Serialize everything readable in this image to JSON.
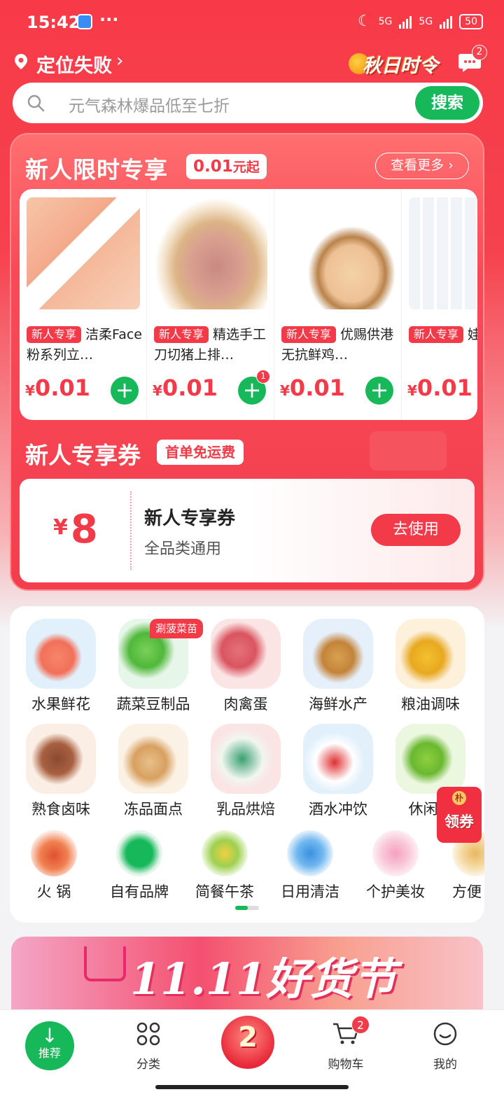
{
  "status": {
    "time": "15:42",
    "dots": "···",
    "net1": "5G",
    "net2": "5G",
    "battery": "50"
  },
  "header": {
    "location": "定位失败",
    "season_badge": "秋日时令",
    "msg_count": "2"
  },
  "search": {
    "placeholder": "元气森林爆品低至七折",
    "button": "搜索"
  },
  "newuser": {
    "title": "新人限时专享",
    "badge_price": "0.01",
    "badge_suffix": "元起",
    "more": "查看更多 ›",
    "products": [
      {
        "tag": "新人专享",
        "name": "洁柔Face粉系列立…",
        "price": "0.01",
        "currency": "¥"
      },
      {
        "tag": "新人专享",
        "name": "精选手工刀切猪上排…",
        "price": "0.01",
        "currency": "¥",
        "cart_count": "1"
      },
      {
        "tag": "新人专享",
        "name": "优赐供港无抗鲜鸡…",
        "price": "0.01",
        "currency": "¥"
      },
      {
        "tag": "新人专享",
        "name": "娃哈哈饮用纯净…",
        "price": "0.01",
        "currency": "¥"
      }
    ]
  },
  "coupon": {
    "section_title": "新人专享券",
    "section_badge": "首单免运费",
    "currency": "¥",
    "amount": "8",
    "name": "新人专享券",
    "desc": "全品类通用",
    "use_button": "去使用"
  },
  "categories": {
    "row1": [
      "水果鲜花",
      "蔬菜豆制品",
      "肉禽蛋",
      "海鲜水产",
      "粮油调味"
    ],
    "row2": [
      "熟食卤味",
      "冻品面点",
      "乳品烘焙",
      "酒水冲饮",
      "休闲零"
    ],
    "row3": [
      "火 锅",
      "自有品牌",
      "简餐午茶",
      "日用清洁",
      "个护美妆",
      "方便"
    ],
    "veg_tag": "涮菠菜苗",
    "float_coupon": "领券",
    "float_coupon_small": "朴"
  },
  "banner": {
    "title": "11.11好货节"
  },
  "nav": {
    "recommend": "推荐",
    "category": "分类",
    "cart": "购物车",
    "cart_count": "2",
    "mine": "我的"
  }
}
